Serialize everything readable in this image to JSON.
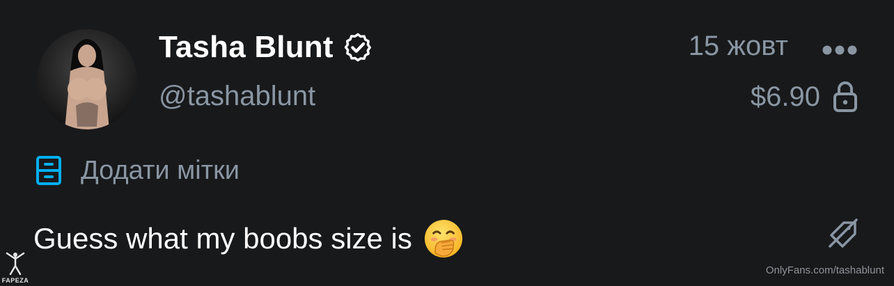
{
  "post_header": {
    "author_name": "Tasha Blunt",
    "author_handle": "@tashablunt",
    "date": "15 жовт",
    "price": "$6.90"
  },
  "tags": {
    "label": "Додати мітки"
  },
  "caption": {
    "text": "Guess what my boobs size is"
  },
  "watermark": {
    "site_text": "OnlyFans.com/tashablunt",
    "brand_text": "FAPEZA"
  },
  "icons": {
    "verified": "verified-badge-icon",
    "more": "more-dots-icon",
    "lock": "lock-icon",
    "tags": "tag-drawer-icon",
    "emoji": "hand-over-mouth-emoji-icon",
    "tip": "tip-off-icon"
  },
  "colors": {
    "background": "#18191b",
    "primary_text": "#ffffff",
    "secondary_text": "#8a96a3",
    "accent_blue": "#00aff0"
  }
}
